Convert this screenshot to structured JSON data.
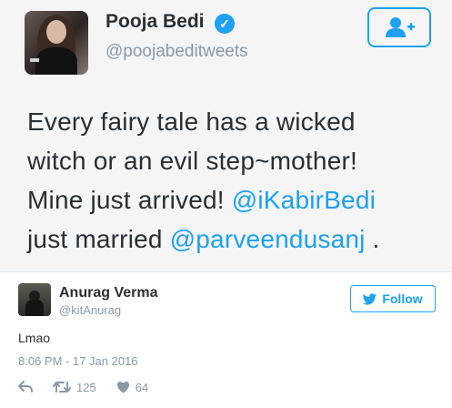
{
  "embedded_tweet": {
    "name": "Pooja Bedi",
    "handle": "@poojabeditweets",
    "text_lines": {
      "line1": "Every fairy tale has a wicked",
      "line2": "witch or an evil step~mother!",
      "line3_pre": "Mine just arrived! ",
      "line3_mention": "@iKabirBedi",
      "line4_pre": "just married ",
      "line4_mention": "@parveendusanj",
      "line4_post": " ."
    }
  },
  "tweet": {
    "name": "Anurag Verma",
    "handle": "@kitAnurag",
    "follow_label": "Follow",
    "text": "Lmao",
    "timestamp": "8:06 PM - 17 Jan 2016",
    "retweets": "125",
    "likes": "64"
  },
  "colors": {
    "accent": "#1da1f2",
    "text": "#292f33",
    "muted": "#8899a6"
  },
  "icons": [
    "verified-icon",
    "add-user-icon",
    "twitter-bird-icon",
    "reply-icon",
    "retweet-icon",
    "heart-icon"
  ]
}
